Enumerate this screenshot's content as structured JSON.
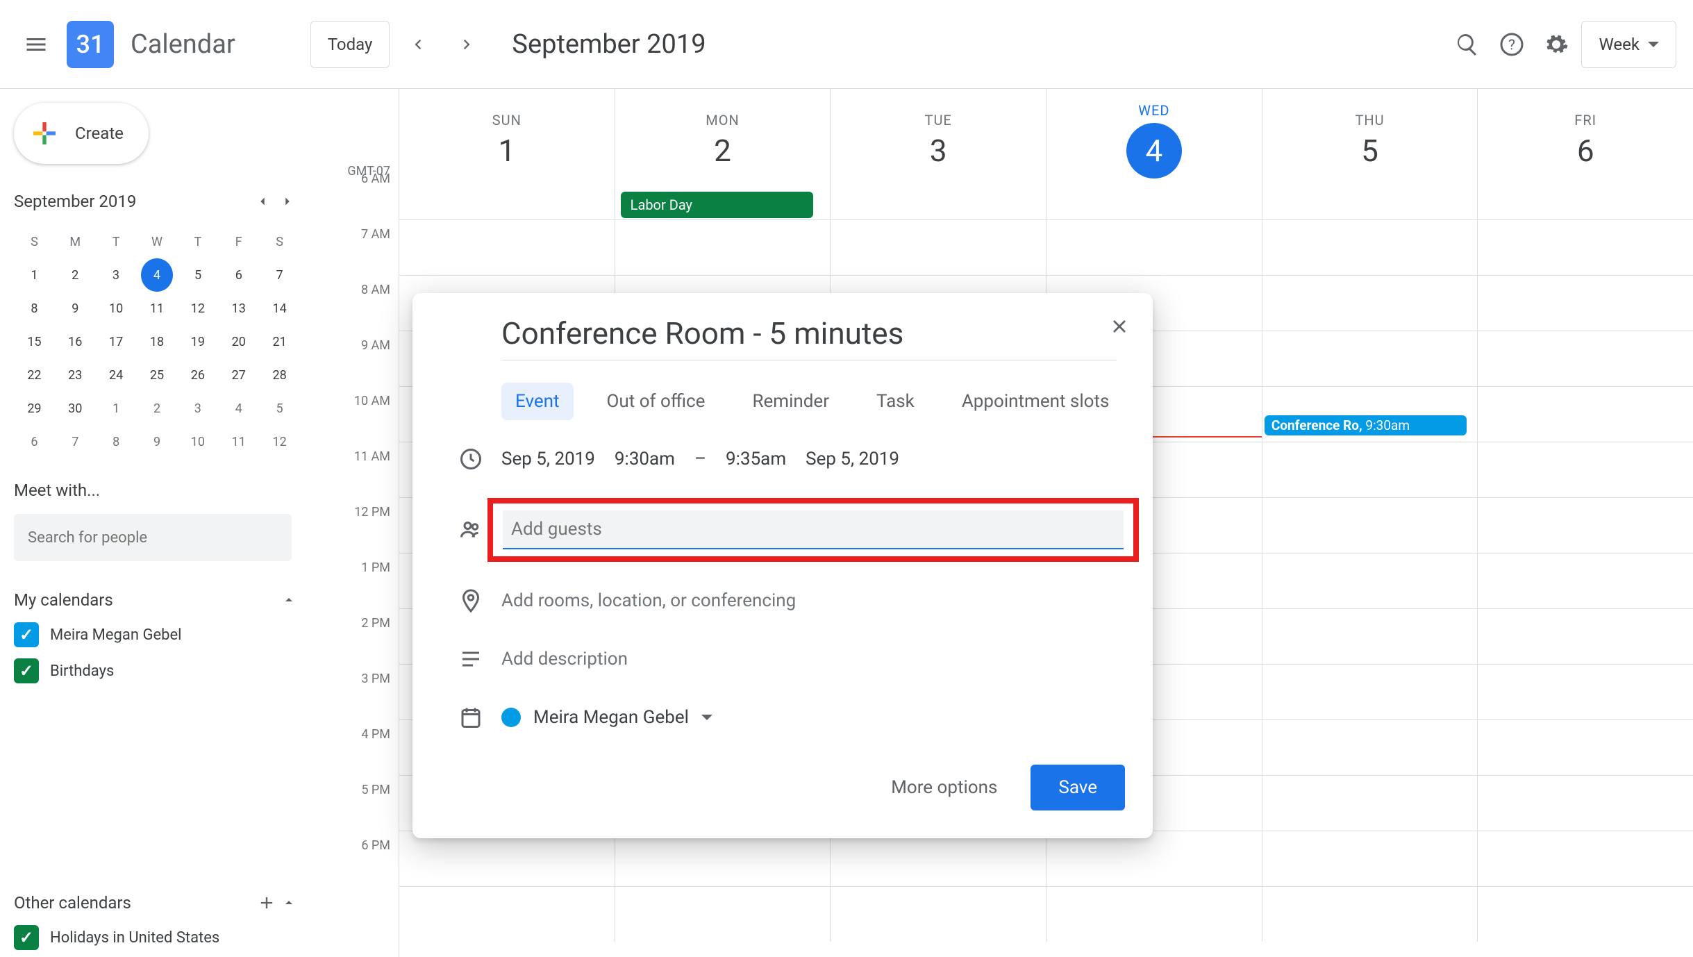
{
  "header": {
    "logo_day": "31",
    "app_title": "Calendar",
    "today_label": "Today",
    "date_label": "September 2019",
    "view_label": "Week"
  },
  "sidebar": {
    "create_label": "Create",
    "mini_month": "September 2019",
    "dow": [
      "S",
      "M",
      "T",
      "W",
      "T",
      "F",
      "S"
    ],
    "weeks": [
      [
        {
          "n": "1"
        },
        {
          "n": "2"
        },
        {
          "n": "3"
        },
        {
          "n": "4",
          "sel": true
        },
        {
          "n": "5"
        },
        {
          "n": "6"
        },
        {
          "n": "7"
        }
      ],
      [
        {
          "n": "8"
        },
        {
          "n": "9"
        },
        {
          "n": "10"
        },
        {
          "n": "11"
        },
        {
          "n": "12"
        },
        {
          "n": "13"
        },
        {
          "n": "14"
        }
      ],
      [
        {
          "n": "15"
        },
        {
          "n": "16"
        },
        {
          "n": "17"
        },
        {
          "n": "18"
        },
        {
          "n": "19"
        },
        {
          "n": "20"
        },
        {
          "n": "21"
        }
      ],
      [
        {
          "n": "22"
        },
        {
          "n": "23"
        },
        {
          "n": "24"
        },
        {
          "n": "25"
        },
        {
          "n": "26"
        },
        {
          "n": "27"
        },
        {
          "n": "28"
        }
      ],
      [
        {
          "n": "29"
        },
        {
          "n": "30"
        },
        {
          "n": "1",
          "o": true
        },
        {
          "n": "2",
          "o": true
        },
        {
          "n": "3",
          "o": true
        },
        {
          "n": "4",
          "o": true
        },
        {
          "n": "5",
          "o": true
        }
      ],
      [
        {
          "n": "6",
          "o": true
        },
        {
          "n": "7",
          "o": true
        },
        {
          "n": "8",
          "o": true
        },
        {
          "n": "9",
          "o": true
        },
        {
          "n": "10",
          "o": true
        },
        {
          "n": "11",
          "o": true
        },
        {
          "n": "12",
          "o": true
        }
      ]
    ],
    "meet_with": "Meet with...",
    "search_placeholder": "Search for people",
    "my_calendars_label": "My calendars",
    "my_calendars": [
      {
        "label": "Meira Megan Gebel",
        "color": "#039be5"
      },
      {
        "label": "Birthdays",
        "color": "#0b8043"
      }
    ],
    "other_calendars_label": "Other calendars",
    "other_calendars": [
      {
        "label": "Holidays in United States",
        "color": "#0b8043"
      }
    ]
  },
  "grid": {
    "tz": "GMT-07",
    "hours": [
      "6 AM",
      "7 AM",
      "8 AM",
      "9 AM",
      "10 AM",
      "11 AM",
      "12 PM",
      "1 PM",
      "2 PM",
      "3 PM",
      "4 PM",
      "5 PM",
      "6 PM"
    ],
    "days": [
      {
        "dow": "SUN",
        "num": "1"
      },
      {
        "dow": "MON",
        "num": "2",
        "allday": {
          "label": "Labor Day",
          "color": "#0b8043"
        }
      },
      {
        "dow": "TUE",
        "num": "3"
      },
      {
        "dow": "WED",
        "num": "4",
        "active": true
      },
      {
        "dow": "THU",
        "num": "5"
      },
      {
        "dow": "FRI",
        "num": "6"
      }
    ],
    "event_chip": {
      "title": "Conference Ro,",
      "time": "9:30am"
    }
  },
  "modal": {
    "title": "Conference Room - 5 minutes",
    "tabs": [
      "Event",
      "Out of office",
      "Reminder",
      "Task",
      "Appointment slots"
    ],
    "active_tab": 0,
    "date_from": "Sep 5, 2019",
    "time_from": "9:30am",
    "dash": "–",
    "time_to": "9:35am",
    "date_to": "Sep 5, 2019",
    "guests_placeholder": "Add guests",
    "location_placeholder": "Add rooms, location, or conferencing",
    "description_placeholder": "Add description",
    "calendar_owner": "Meira Megan Gebel",
    "more_options_label": "More options",
    "save_label": "Save"
  }
}
